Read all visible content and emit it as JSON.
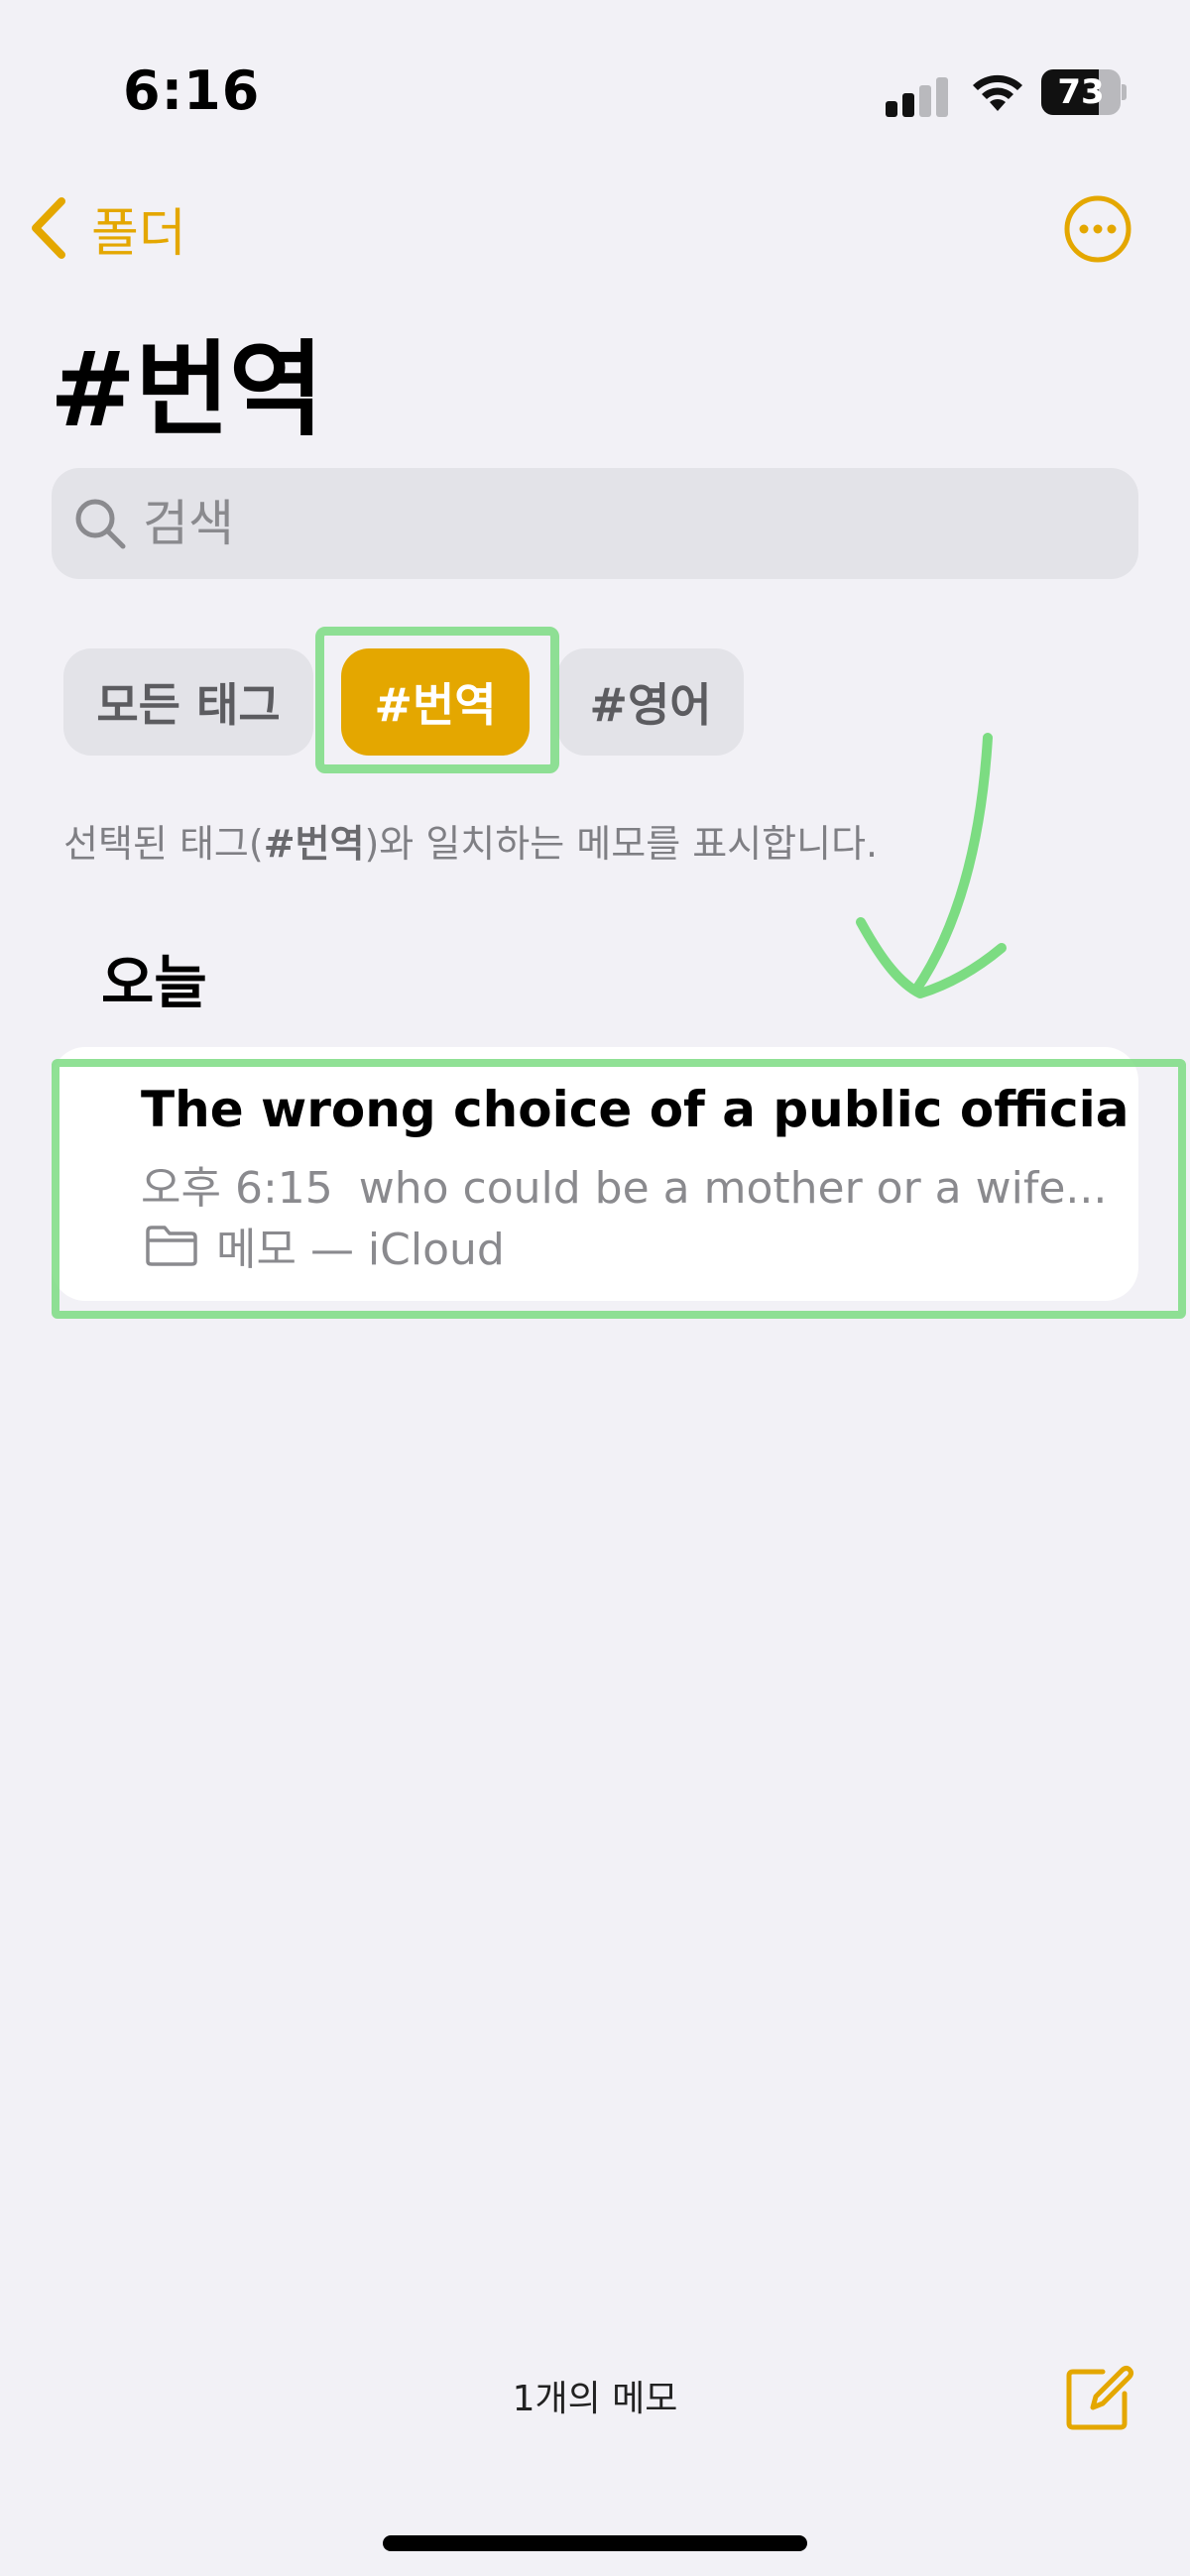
{
  "status_bar": {
    "time": "6:16",
    "battery_level": "73"
  },
  "nav": {
    "back_label": "폴더"
  },
  "page": {
    "title": "#번역"
  },
  "search": {
    "placeholder": "검색",
    "value": ""
  },
  "tags": {
    "items": [
      {
        "label": "모든 태그",
        "selected": false
      },
      {
        "label": "#번역",
        "selected": true
      },
      {
        "label": "#영어",
        "selected": false
      }
    ]
  },
  "filter_hint": {
    "prefix": "선택된 태그(",
    "tag": "#번역",
    "suffix": ")와 일치하는 메모를 표시합니다."
  },
  "sections": [
    {
      "header": "오늘",
      "notes": [
        {
          "title": "The wrong choice of a public official...",
          "time": "오후 6:15",
          "preview": "who could be a mother or a wife...",
          "folder": "메모 — iCloud"
        }
      ]
    }
  ],
  "footer": {
    "note_count": "1개의 메모"
  },
  "colors": {
    "accent": "#e4a700",
    "background": "#f2f1f6",
    "annotation": "#7cdc82"
  }
}
